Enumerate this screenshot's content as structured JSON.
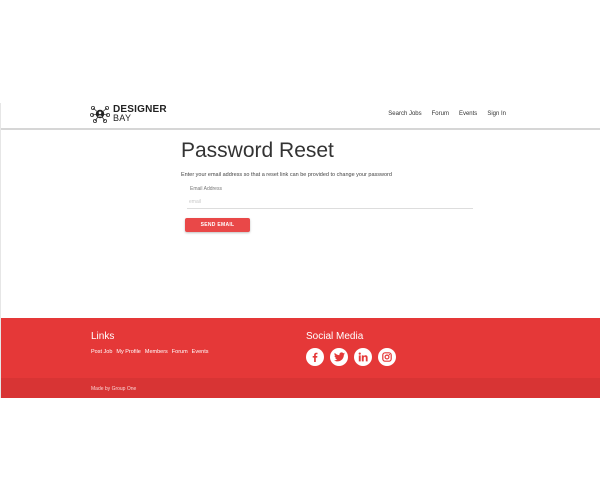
{
  "header": {
    "logo_line1": "DESIGNER",
    "logo_line2": "BAY",
    "nav": [
      "Search Jobs",
      "Forum",
      "Events",
      "Sign In"
    ]
  },
  "main": {
    "title": "Password Reset",
    "description": "Enter your email address so that a reset link can be provided to change your password",
    "email_label": "Email Address",
    "email_placeholder": "email",
    "send_button": "SEND EMAIL"
  },
  "footer": {
    "links_title": "Links",
    "links": [
      "Post Job",
      "My Profile",
      "Members",
      "Forum",
      "Events"
    ],
    "social_title": "Social Media",
    "social_icons": [
      "facebook-icon",
      "twitter-icon",
      "linkedin-icon",
      "instagram-icon"
    ],
    "credit": "Made by Group One"
  },
  "colors": {
    "accent": "#e53838",
    "button": "#e94848",
    "footer_bottom": "#d83434"
  }
}
